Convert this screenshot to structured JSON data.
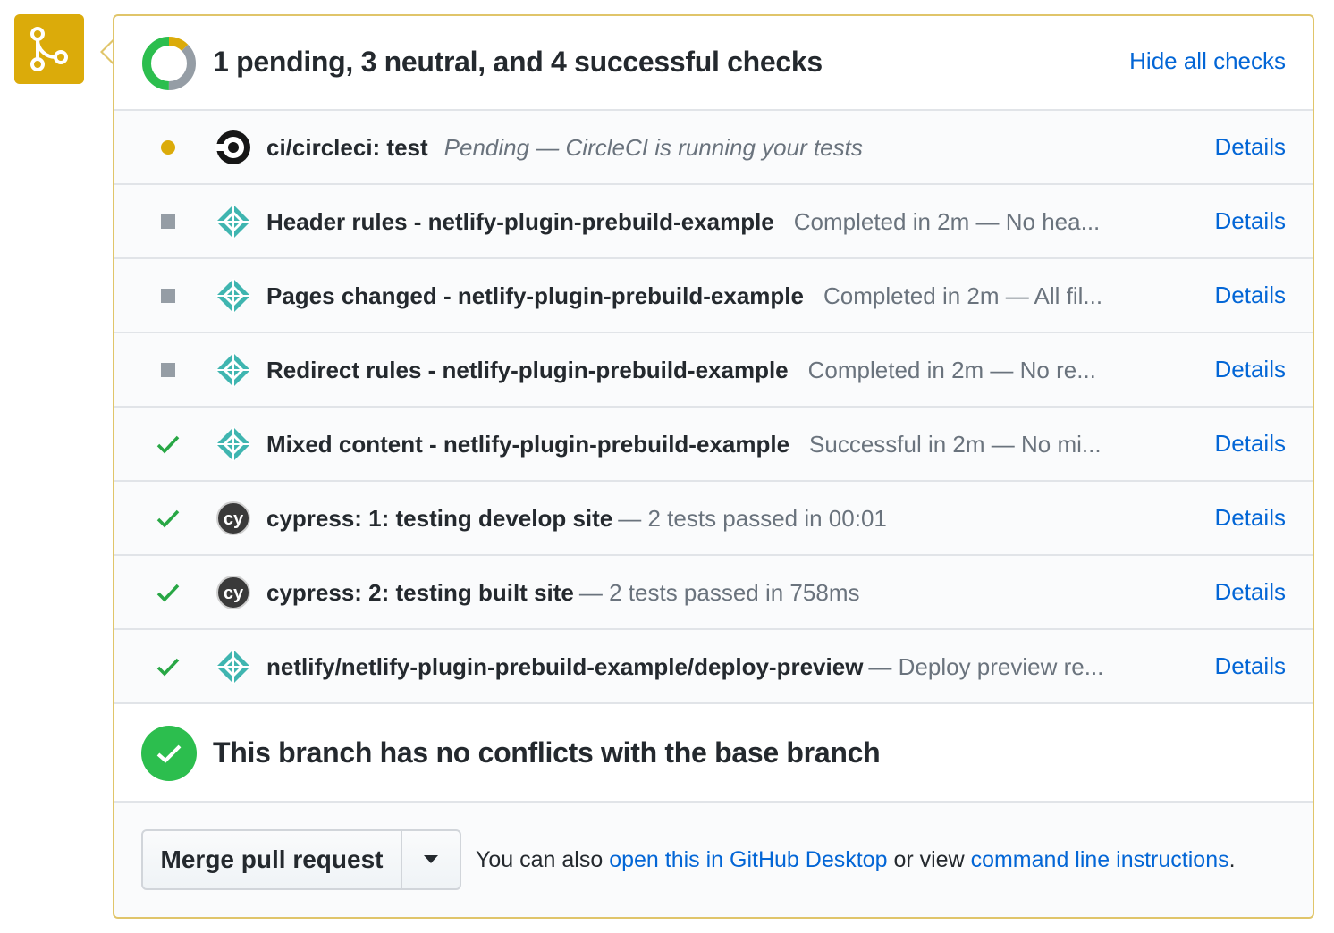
{
  "header": {
    "title": "1 pending, 3 neutral, and 4 successful checks",
    "hide_label": "Hide all checks",
    "donut": {
      "pending": 1,
      "neutral": 3,
      "successful": 4,
      "colors": {
        "pending": "#dbab0a",
        "neutral": "#959da5",
        "successful": "#2cbe4e"
      }
    }
  },
  "checks": [
    {
      "status": "pending",
      "avatar": "circleci-icon",
      "name": "ci/circleci: test",
      "desc": "Pending — CircleCI is running your tests",
      "details": "Details"
    },
    {
      "status": "neutral",
      "avatar": "netlify-icon",
      "name": "Header rules - netlify-plugin-prebuild-example",
      "desc": "Completed in 2m — No hea...",
      "details": "Details"
    },
    {
      "status": "neutral",
      "avatar": "netlify-icon",
      "name": "Pages changed - netlify-plugin-prebuild-example",
      "desc": "Completed in 2m — All fil...",
      "details": "Details"
    },
    {
      "status": "neutral",
      "avatar": "netlify-icon",
      "name": "Redirect rules - netlify-plugin-prebuild-example",
      "desc": "Completed in 2m — No re...",
      "details": "Details"
    },
    {
      "status": "success",
      "avatar": "netlify-icon",
      "name": "Mixed content - netlify-plugin-prebuild-example",
      "desc": "Successful in 2m — No mi...",
      "details": "Details"
    },
    {
      "status": "success",
      "avatar": "cypress-icon",
      "name": "cypress: 1: testing develop site",
      "desc": "— 2 tests passed in 00:01",
      "details": "Details"
    },
    {
      "status": "success",
      "avatar": "cypress-icon",
      "name": "cypress: 2: testing built site",
      "desc": "— 2 tests passed in 758ms",
      "details": "Details"
    },
    {
      "status": "success",
      "avatar": "netlify-icon",
      "name": "netlify/netlify-plugin-prebuild-example/deploy-preview",
      "desc": "— Deploy preview re...",
      "details": "Details"
    }
  ],
  "conflicts": {
    "title": "This branch has no conflicts with the base branch"
  },
  "merge": {
    "button_label": "Merge pull request",
    "note_prefix": "You can also",
    "desktop_link": "open this in GitHub Desktop",
    "note_middle": "or view",
    "cli_link": "command line instructions",
    "note_suffix": "."
  },
  "colors": {
    "accent_link": "#0366d6",
    "merge_icon_bg": "#dbab0a",
    "panel_border": "#e0c56a"
  }
}
